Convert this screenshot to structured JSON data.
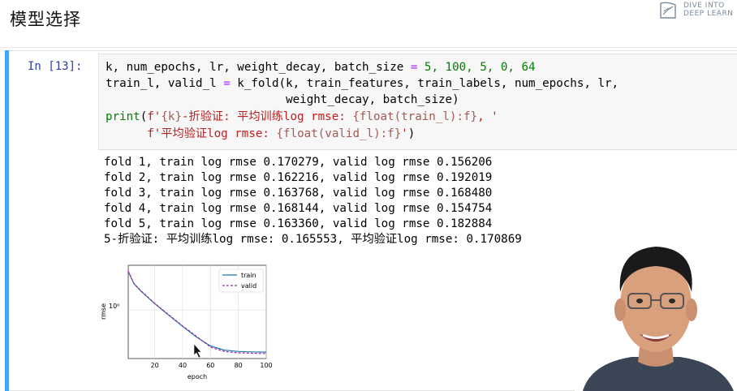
{
  "slide": {
    "title": "模型选择"
  },
  "logo": {
    "line1": "DIVE INTO",
    "line2": "DEEP LEARN"
  },
  "cell": {
    "prompt": "In [13]:",
    "code": {
      "line1_a": "k, num_epochs, lr, weight_decay, batch_size ",
      "line1_eq": "=",
      "line1_vals": " 5, 100, 5, 0, 64",
      "line2_a": "train_l, valid_l ",
      "line2_eq": "=",
      "line2_b": " k_fold(k, train_features, train_labels, num_epochs, lr,",
      "line3": "                          weight_decay, batch_size)",
      "line4_print": "print",
      "line4_open": "(",
      "line4_s1": "f'",
      "line4_b1": "{k}",
      "line4_s2": "-折验证: 平均训练log rmse: ",
      "line4_b2": "{float(train_l):f}",
      "line4_s3": ", '",
      "line5_indent": "      ",
      "line5_s1": "f'平均验证log rmse: ",
      "line5_b1": "{float(valid_l):f}",
      "line5_s2": "'",
      "line5_close": ")"
    },
    "output": [
      "fold 1, train log rmse 0.170279, valid log rmse 0.156206",
      "fold 2, train log rmse 0.162216, valid log rmse 0.192019",
      "fold 3, train log rmse 0.163768, valid log rmse 0.168480",
      "fold 4, train log rmse 0.168144, valid log rmse 0.154754",
      "fold 5, train log rmse 0.163360, valid log rmse 0.182884",
      "5-折验证: 平均训练log rmse: 0.165553, 平均验证log rmse: 0.170869"
    ]
  },
  "chart_data": {
    "type": "line",
    "xlabel": "epoch",
    "ylabel": "rmse",
    "y_scale": "log",
    "xlim": [
      1,
      100
    ],
    "x_ticks": [
      "20",
      "40",
      "60",
      "80",
      "100"
    ],
    "y_ticks": [
      "10⁰"
    ],
    "grid": true,
    "legend_position": "top-right",
    "series": [
      {
        "name": "train",
        "color": "#1f77b4",
        "style": "solid",
        "x": [
          1,
          5,
          10,
          20,
          30,
          40,
          50,
          60,
          70,
          80,
          90,
          100
        ],
        "y": [
          5.0,
          3.0,
          2.2,
          1.3,
          0.8,
          0.5,
          0.32,
          0.22,
          0.185,
          0.175,
          0.172,
          0.17
        ]
      },
      {
        "name": "valid",
        "color": "#9b2f9b",
        "style": "dashed",
        "x": [
          1,
          5,
          10,
          20,
          30,
          40,
          50,
          60,
          70,
          80,
          90,
          100
        ],
        "y": [
          5.1,
          3.05,
          2.25,
          1.32,
          0.82,
          0.51,
          0.33,
          0.21,
          0.175,
          0.165,
          0.162,
          0.16
        ]
      }
    ]
  },
  "colors": {
    "cell_border": "#42a5f5",
    "prompt": "#303f9f"
  },
  "icons": {
    "cursor": "arrow-cursor-icon",
    "logo": "dive-into-dl-logo-icon"
  }
}
